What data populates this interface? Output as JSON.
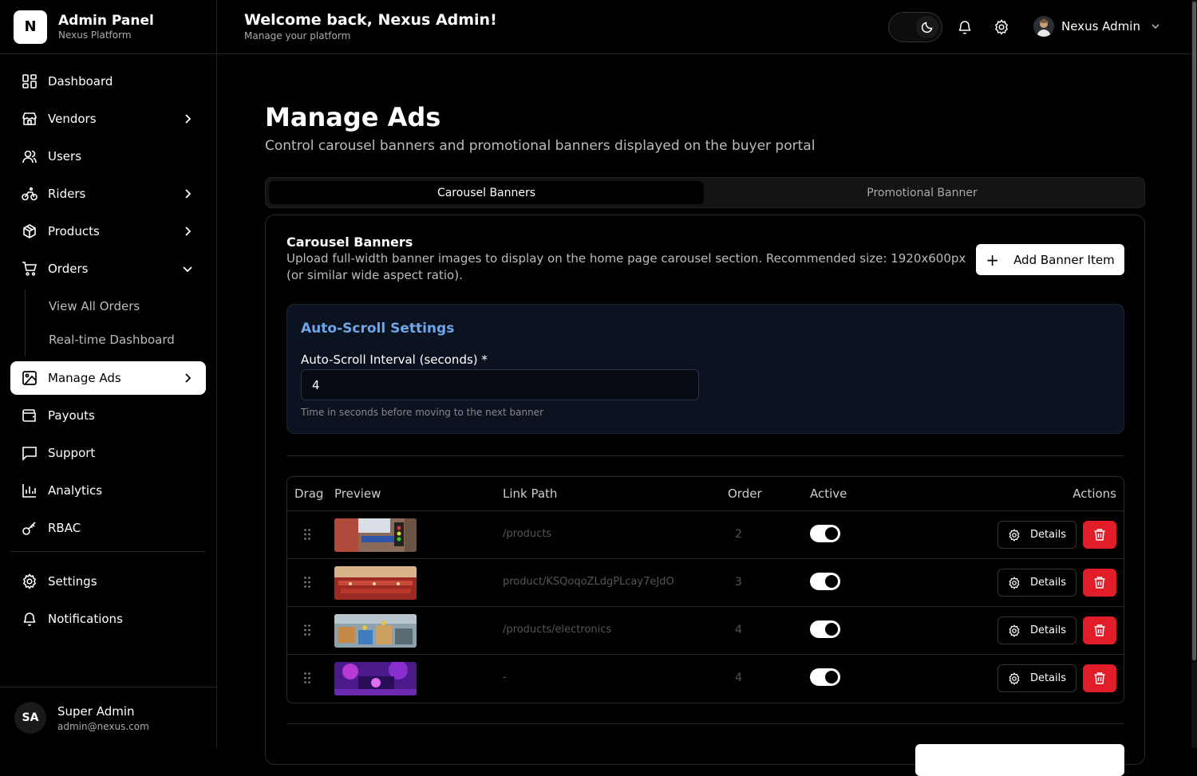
{
  "brand": {
    "logo_letter": "N",
    "title": "Admin Panel",
    "subtitle": "Nexus Platform"
  },
  "nav": {
    "dashboard": "Dashboard",
    "vendors": "Vendors",
    "users": "Users",
    "riders": "Riders",
    "products": "Products",
    "orders": "Orders",
    "orders_sub": [
      "View All Orders",
      "Real-time Dashboard"
    ],
    "manage_ads": "Manage Ads",
    "payouts": "Payouts",
    "support": "Support",
    "analytics": "Analytics",
    "rbac": "RBAC",
    "settings": "Settings",
    "notifications": "Notifications"
  },
  "footer_user": {
    "initials": "SA",
    "name": "Super Admin",
    "email": "admin@nexus.com"
  },
  "header": {
    "welcome": "Welcome back, Nexus Admin!",
    "subtitle": "Manage your platform",
    "profile_name": "Nexus Admin"
  },
  "page": {
    "title": "Manage Ads",
    "subtitle": "Control carousel banners and promotional banners displayed on the buyer portal"
  },
  "tabs": [
    "Carousel Banners",
    "Promotional Banner"
  ],
  "card": {
    "title": "Carousel Banners",
    "description": "Upload full-width banner images to display on the home page carousel section. Recommended size: 1920x600px (or similar wide aspect ratio).",
    "add_button": "Add Banner Item"
  },
  "auto_scroll": {
    "heading": "Auto-Scroll Settings",
    "label": "Auto-Scroll Interval (seconds) *",
    "value": "4",
    "hint": "Time in seconds before moving to the next banner"
  },
  "table": {
    "headers": [
      "Drag",
      "Preview",
      "Link Path",
      "Order",
      "Active",
      "Actions"
    ],
    "details_label": "Details",
    "rows": [
      {
        "link": "/products",
        "order": "2",
        "active": true
      },
      {
        "link": "product/KSQoqoZLdgPLcay7eJdO",
        "order": "3",
        "active": true
      },
      {
        "link": "/products/electronics",
        "order": "4",
        "active": true
      },
      {
        "link": "-",
        "order": "4",
        "active": true
      }
    ]
  },
  "colors": {
    "accent_blue": "#6fa5ea",
    "danger": "#e11d2a",
    "bg": "#000000"
  }
}
